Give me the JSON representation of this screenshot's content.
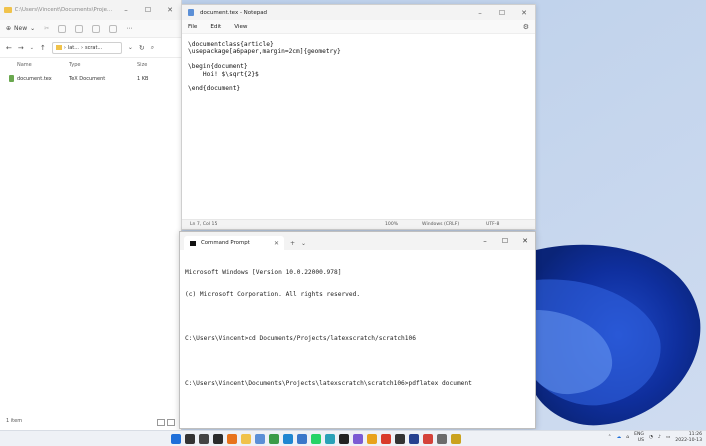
{
  "explorer": {
    "title": "C:\\Users\\Vincent\\Documents\\Projects\\latexsc...",
    "toolbar": {
      "new_label": "New"
    },
    "address": {
      "seg1": "lat...",
      "seg2": "scrat..."
    },
    "columns": {
      "name": "Name",
      "type": "Type",
      "size": "Size"
    },
    "files": [
      {
        "name": "document.tex",
        "type": "TeX Document",
        "size": "1 KB"
      }
    ],
    "status": "1 item"
  },
  "notepad": {
    "title": "document.tex - Notepad",
    "menu": {
      "file": "File",
      "edit": "Edit",
      "view": "View"
    },
    "content": "\\documentclass{article}\n\\usepackage[a6paper,margin=2cm]{geometry}\n\n\\begin{document}\n    Hoi! $\\sqrt{2}$\n\n\\end{document}",
    "status": {
      "position": "Ln 7, Col 15",
      "zoom": "100%",
      "line_ending": "Windows (CRLF)",
      "encoding": "UTF-8"
    }
  },
  "cmd": {
    "tab_title": "Command Prompt",
    "lines": [
      "Microsoft Windows [Version 10.0.22000.978]",
      "(c) Microsoft Corporation. All rights reserved.",
      "",
      "C:\\Users\\Vincent>cd Documents/Projects/latexscratch/scratch106",
      "",
      "C:\\Users\\Vincent\\Documents\\Projects\\latexscratch\\scratch106>pdflatex document"
    ]
  },
  "taskbar": {
    "apps": [
      {
        "icon": "start-icon",
        "color": "#1e6fd9"
      },
      {
        "icon": "search-icon",
        "color": "#333333"
      },
      {
        "icon": "taskview-icon",
        "color": "#444444"
      },
      {
        "icon": "terminal-icon",
        "color": "#2b2b2b"
      },
      {
        "icon": "firefox-icon",
        "color": "#e8731c"
      },
      {
        "icon": "explorer-icon",
        "color": "#f0c24a"
      },
      {
        "icon": "notepad-icon",
        "color": "#5b8fd6"
      },
      {
        "icon": "app-green-icon",
        "color": "#3b9b48"
      },
      {
        "icon": "vscode-icon",
        "color": "#1f86d1"
      },
      {
        "icon": "app-blue-icon",
        "color": "#3a77c9"
      },
      {
        "icon": "whatsapp-icon",
        "color": "#25d366"
      },
      {
        "icon": "app-teal-icon",
        "color": "#2aa1b7"
      },
      {
        "icon": "github-icon",
        "color": "#222222"
      },
      {
        "icon": "app-purple-icon",
        "color": "#7b5bd3"
      },
      {
        "icon": "app-orange-icon",
        "color": "#e8a21c"
      },
      {
        "icon": "app-red-icon",
        "color": "#d93b2b"
      },
      {
        "icon": "app-dark-icon",
        "color": "#333333"
      },
      {
        "icon": "app-navy-icon",
        "color": "#26418f"
      },
      {
        "icon": "app-redround-icon",
        "color": "#d4423a"
      },
      {
        "icon": "settings-icon",
        "color": "#6b6b6b"
      },
      {
        "icon": "app-yellow-icon",
        "color": "#caa21e"
      }
    ],
    "tray": {
      "lang_top": "ENG",
      "lang_bottom": "US",
      "time": "11:26",
      "date": "2022-10-13"
    }
  }
}
